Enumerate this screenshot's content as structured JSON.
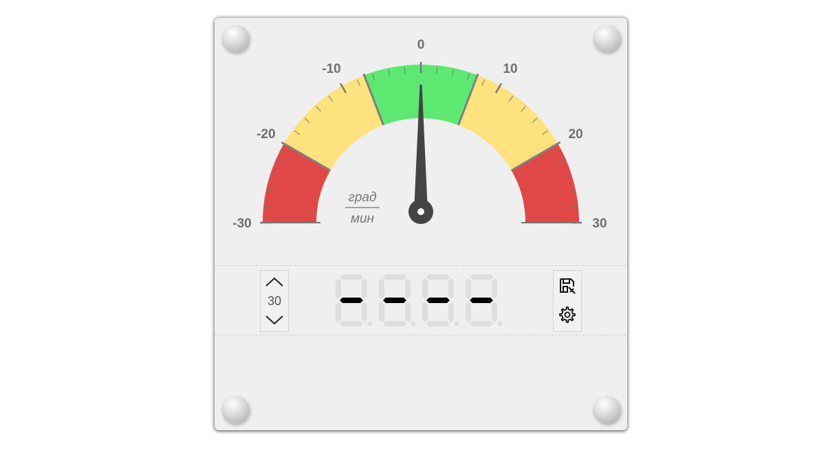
{
  "gauge": {
    "unit_numerator": "град",
    "unit_denominator": "мин",
    "scale_min": -30,
    "scale_max": 30,
    "major_labels": [
      "-30",
      "-20",
      "-10",
      "0",
      "10",
      "20",
      "30"
    ],
    "needle_value": 0,
    "zones": [
      {
        "from": -30,
        "to": -20,
        "color": "#e04848"
      },
      {
        "from": -20,
        "to": -7,
        "color": "#fde27e"
      },
      {
        "from": -7,
        "to": 7,
        "color": "#5de872"
      },
      {
        "from": 7,
        "to": 20,
        "color": "#fde27e"
      },
      {
        "from": 20,
        "to": 30,
        "color": "#e04848"
      }
    ]
  },
  "range_control": {
    "value": "30",
    "up_icon": "chevron-up-icon",
    "down_icon": "chevron-down-icon"
  },
  "display": {
    "digits": [
      "-",
      "-",
      "-",
      "-"
    ]
  },
  "tools": {
    "save_icon": "save-icon",
    "settings_icon": "gear-icon"
  }
}
